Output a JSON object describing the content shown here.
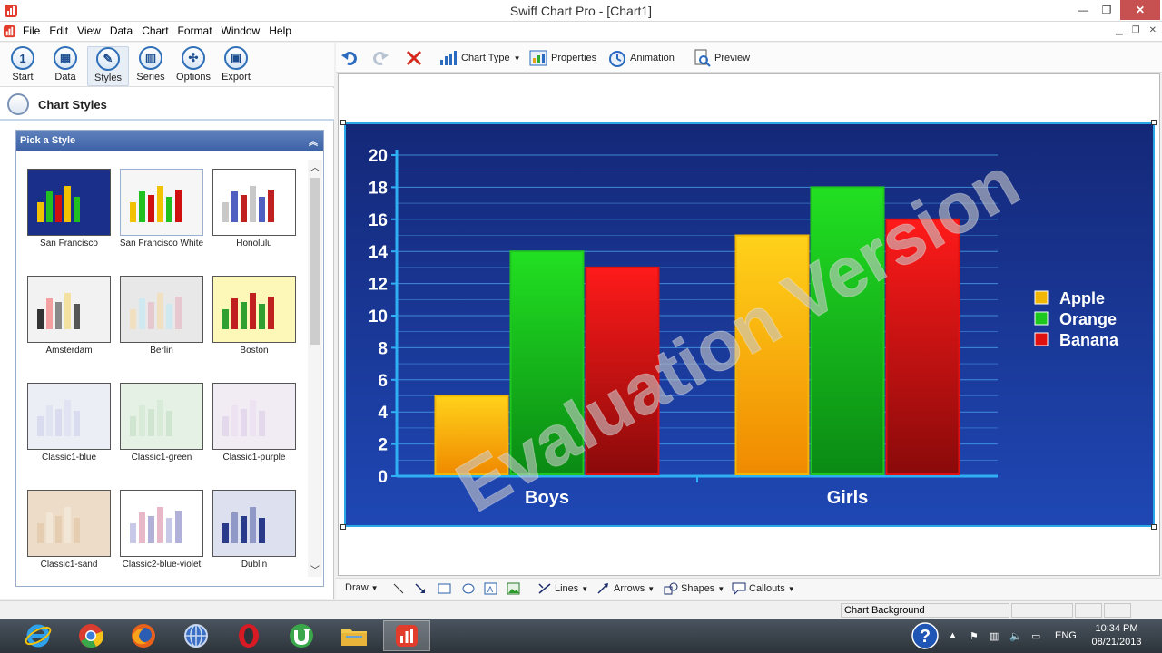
{
  "window": {
    "title": "Swiff Chart Pro - [Chart1]"
  },
  "menu": [
    "File",
    "Edit",
    "View",
    "Data",
    "Chart",
    "Format",
    "Window",
    "Help"
  ],
  "nav": [
    {
      "label": "Start",
      "glyph": "1"
    },
    {
      "label": "Data",
      "glyph": "▦"
    },
    {
      "label": "Styles",
      "glyph": "✎"
    },
    {
      "label": "Series",
      "glyph": "▥"
    },
    {
      "label": "Options",
      "glyph": "✣"
    },
    {
      "label": "Export",
      "glyph": "▣"
    }
  ],
  "panel": {
    "title": "Chart Styles",
    "pick_title": "Pick a Style"
  },
  "styles": [
    {
      "name": "San Francisco",
      "bg": "#1a2f8a",
      "b": [
        "#f2c100",
        "#1fc01f",
        "#d01010",
        "#f2c100",
        "#1fc01f"
      ]
    },
    {
      "name": "San Francisco White",
      "bg": "#f6f6f6",
      "b": [
        "#f2c100",
        "#1fc01f",
        "#d01010",
        "#f2c100",
        "#1fc01f",
        "#d01010"
      ]
    },
    {
      "name": "Honolulu",
      "bg": "#ffffff",
      "b": [
        "#c8c8c8",
        "#5060c0",
        "#c02020",
        "#c8c8c8",
        "#5060c0",
        "#c02020"
      ]
    },
    {
      "name": "Amsterdam",
      "bg": "#f2f2f2",
      "b": [
        "#333333",
        "#f4a0a0",
        "#888888",
        "#f4e0a0",
        "#555555"
      ]
    },
    {
      "name": "Berlin",
      "bg": "#e8e8e8",
      "b": [
        "#f0e0c0",
        "#d0e8f0",
        "#e8c8d0",
        "#f0e0c0",
        "#d0e8f0",
        "#e8c8d0"
      ]
    },
    {
      "name": "Boston",
      "bg": "#fdf7b8",
      "b": [
        "#30a030",
        "#c02020",
        "#30a030",
        "#c02020",
        "#30a030",
        "#c02020"
      ]
    },
    {
      "name": "Classic1-blue",
      "bg": "#eceef6",
      "b": [
        "#d8dcee",
        "#e0e4f2",
        "#d8dcee",
        "#e0e4f2",
        "#d8dcee"
      ]
    },
    {
      "name": "Classic1-green",
      "bg": "#e6f1e6",
      "b": [
        "#cfe5cf",
        "#d8ead8",
        "#cfe5cf",
        "#d8ead8",
        "#cfe5cf"
      ]
    },
    {
      "name": "Classic1-purple",
      "bg": "#f1ecf4",
      "b": [
        "#e4d8ec",
        "#ece2f2",
        "#e4d8ec",
        "#ece2f2",
        "#e4d8ec"
      ]
    },
    {
      "name": "Classic1-sand",
      "bg": "#ecdcc8",
      "b": [
        "#e4cdb0",
        "#f2e6d6",
        "#e4cdb0",
        "#f2e6d6",
        "#e4cdb0"
      ]
    },
    {
      "name": "Classic2-blue-violet",
      "bg": "#ffffff",
      "b": [
        "#c8c8e8",
        "#e8b8c8",
        "#b0b0d8",
        "#e8b8c8",
        "#c8c8e8",
        "#b0b0d8"
      ]
    },
    {
      "name": "Dublin",
      "bg": "#dde1ef",
      "b": [
        "#2a3a8a",
        "#9098c8",
        "#2a3a8a",
        "#9098c8",
        "#2a3a8a"
      ]
    }
  ],
  "toolbar": {
    "chart_type": "Chart Type",
    "properties": "Properties",
    "animation": "Animation",
    "preview": "Preview"
  },
  "chart_data": {
    "type": "bar",
    "categories": [
      "Boys",
      "Girls"
    ],
    "series": [
      {
        "name": "Apple",
        "values": [
          5,
          15
        ],
        "color": "#f2b705"
      },
      {
        "name": "Orange",
        "values": [
          14,
          18
        ],
        "color": "#1ec81e"
      },
      {
        "name": "Banana",
        "values": [
          13,
          16
        ],
        "color": "#e01010"
      }
    ],
    "yticks": [
      "20",
      "18",
      "16",
      "14",
      "12",
      "10",
      "8",
      "6",
      "4",
      "2",
      "0"
    ],
    "ylim": [
      0,
      20
    ],
    "background": "#1a3590",
    "legend": "right",
    "watermark": "Evaluation Version"
  },
  "drawbar": {
    "draw": "Draw",
    "lines": "Lines",
    "arrows": "Arrows",
    "shapes": "Shapes",
    "callouts": "Callouts"
  },
  "status": {
    "selection": "Chart Background"
  },
  "taskbar": {
    "lang": "ENG",
    "time": "10:34 PM",
    "date": "08/21/2013"
  }
}
